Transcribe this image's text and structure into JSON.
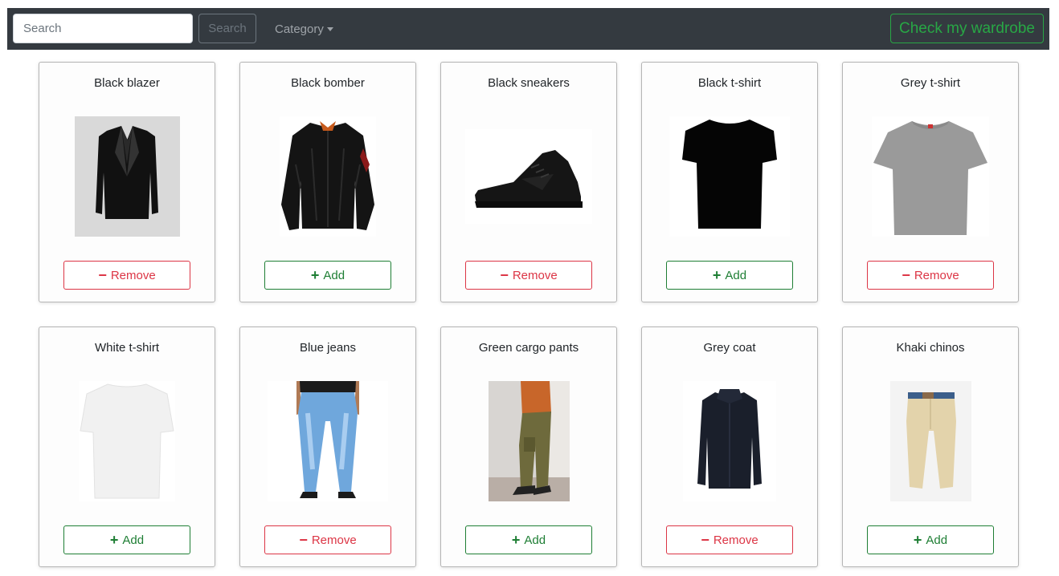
{
  "navbar": {
    "search_placeholder": "Search",
    "search_button": "Search",
    "category_label": "Category",
    "wardrobe_button": "Check my wardrobe"
  },
  "colors": {
    "navbar_bg": "#343a40",
    "add": "#1e7e34",
    "remove": "#dc3545",
    "wardrobe": "#28a745"
  },
  "items": [
    {
      "name": "Black blazer",
      "icon": "blazer-icon",
      "action": "remove",
      "action_label": "Remove",
      "action_symbol": "−"
    },
    {
      "name": "Black bomber",
      "icon": "bomber-jacket-icon",
      "action": "add",
      "action_label": "Add",
      "action_symbol": "+"
    },
    {
      "name": "Black sneakers",
      "icon": "sneaker-icon",
      "action": "remove",
      "action_label": "Remove",
      "action_symbol": "−"
    },
    {
      "name": "Black t-shirt",
      "icon": "tshirt-icon",
      "action": "add",
      "action_label": "Add",
      "action_symbol": "+"
    },
    {
      "name": "Grey t-shirt",
      "icon": "tshirt-icon",
      "action": "remove",
      "action_label": "Remove",
      "action_symbol": "−"
    },
    {
      "name": "White t-shirt",
      "icon": "tshirt-icon",
      "action": "add",
      "action_label": "Add",
      "action_symbol": "+"
    },
    {
      "name": "Blue jeans",
      "icon": "jeans-icon",
      "action": "remove",
      "action_label": "Remove",
      "action_symbol": "−"
    },
    {
      "name": "Green cargo pants",
      "icon": "cargo-pants-icon",
      "action": "add",
      "action_label": "Add",
      "action_symbol": "+"
    },
    {
      "name": "Grey coat",
      "icon": "coat-icon",
      "action": "remove",
      "action_label": "Remove",
      "action_symbol": "−"
    },
    {
      "name": "Khaki chinos",
      "icon": "chinos-icon",
      "action": "add",
      "action_label": "Add",
      "action_symbol": "+"
    }
  ]
}
